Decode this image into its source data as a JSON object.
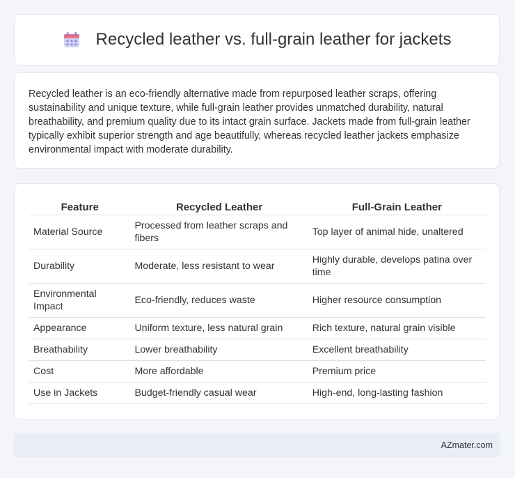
{
  "header": {
    "title": "Recycled leather vs. full-grain leather for jackets",
    "icon": "calendar-icon",
    "icon_colors": {
      "top": "#e8708a",
      "body": "#c9c6ef",
      "grid": "#8b85d6"
    }
  },
  "summary": {
    "text": "Recycled leather is an eco-friendly alternative made from repurposed leather scraps, offering sustainability and unique texture, while full-grain leather provides unmatched durability, natural breathability, and premium quality due to its intact grain surface. Jackets made from full-grain leather typically exhibit superior strength and age beautifully, whereas recycled leather jackets emphasize environmental impact with moderate durability."
  },
  "table": {
    "headers": [
      "Feature",
      "Recycled Leather",
      "Full-Grain Leather"
    ],
    "rows": [
      [
        "Material Source",
        "Processed from leather scraps and fibers",
        "Top layer of animal hide, unaltered"
      ],
      [
        "Durability",
        "Moderate, less resistant to wear",
        "Highly durable, develops patina over time"
      ],
      [
        "Environmental Impact",
        "Eco-friendly, reduces waste",
        "Higher resource consumption"
      ],
      [
        "Appearance",
        "Uniform texture, less natural grain",
        "Rich texture, natural grain visible"
      ],
      [
        "Breathability",
        "Lower breathability",
        "Excellent breathability"
      ],
      [
        "Cost",
        "More affordable",
        "Premium price"
      ],
      [
        "Use in Jackets",
        "Budget-friendly casual wear",
        "High-end, long-lasting fashion"
      ]
    ]
  },
  "footer": {
    "brand": "AZmater.com"
  }
}
